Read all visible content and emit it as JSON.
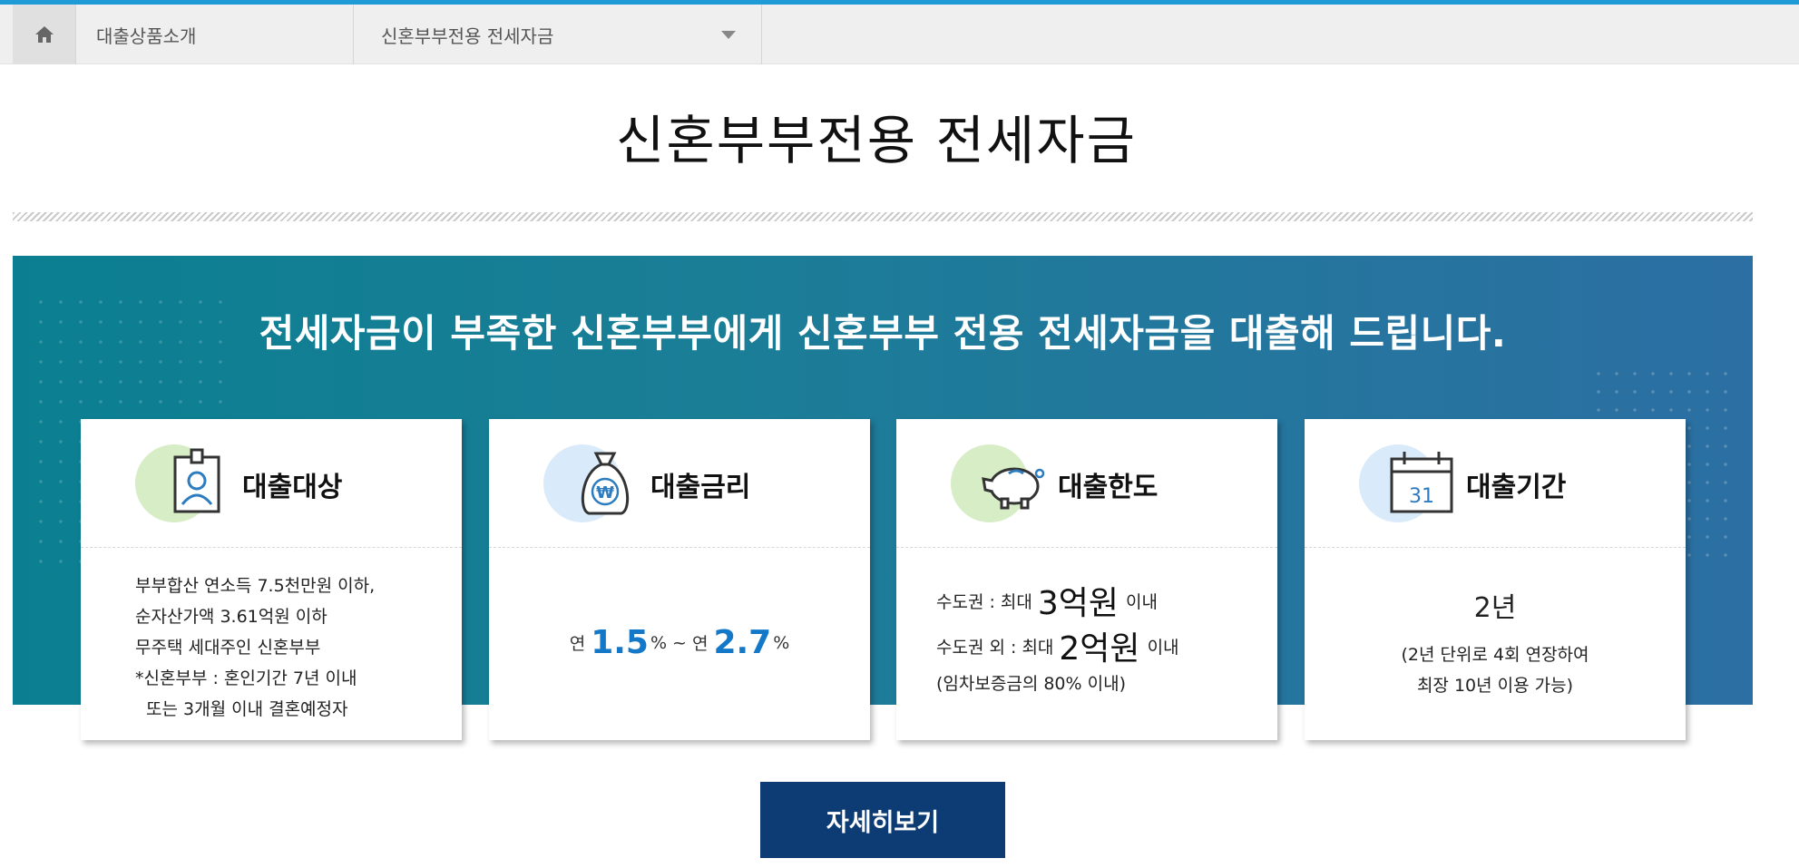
{
  "breadcrumb": {
    "home_icon": "home-icon",
    "level1": "대출상품소개",
    "level2": "신혼부부전용 전세자금",
    "dropdown_icon": "chevron-down-icon"
  },
  "page": {
    "title": "신혼부부전용 전세자금"
  },
  "banner": {
    "headline": "전세자금이 부족한 신혼부부에게 신혼부부 전용 전세자금을 대출해 드립니다."
  },
  "cards": {
    "target": {
      "icon": "id-badge-icon",
      "title": "대출대상",
      "lines": [
        "부부합산 연소득 7.5천만원 이하,",
        "순자산가액 3.61억원 이하",
        "무주택 세대주인 신혼부부",
        "*신혼부부 : 혼인기간 7년 이내",
        "또는 3개월 이내 결혼예정자"
      ]
    },
    "rate": {
      "icon": "money-bag-icon",
      "title": "대출금리",
      "prefix_min": "연",
      "min": "1.5",
      "unit_min": "%",
      "separator": "~",
      "prefix_max": "연",
      "max": "2.7",
      "unit_max": "%"
    },
    "limit": {
      "icon": "piggy-bank-icon",
      "title": "대출한도",
      "capital_label": "수도권 : 최대",
      "capital_amount": "3억원",
      "capital_suffix": "이내",
      "other_label": "수도권 외 : 최대",
      "other_amount": "2억원",
      "other_suffix": "이내",
      "note": "(임차보증금의 80% 이내)"
    },
    "period": {
      "icon": "calendar-icon",
      "title": "대출기간",
      "value": "2년",
      "sub_line1": "(2년 단위로 4회 연장하여",
      "sub_line2": "최장 10년 이용 가능)",
      "calendar_day": "31"
    }
  },
  "actions": {
    "details_button": "자세히보기"
  },
  "colors": {
    "accent_top": "#1e9bd7",
    "banner_start": "#0b7f91",
    "banner_end": "#2c6fa3",
    "rate_highlight": "#1478c8",
    "button": "#0d3b73"
  }
}
